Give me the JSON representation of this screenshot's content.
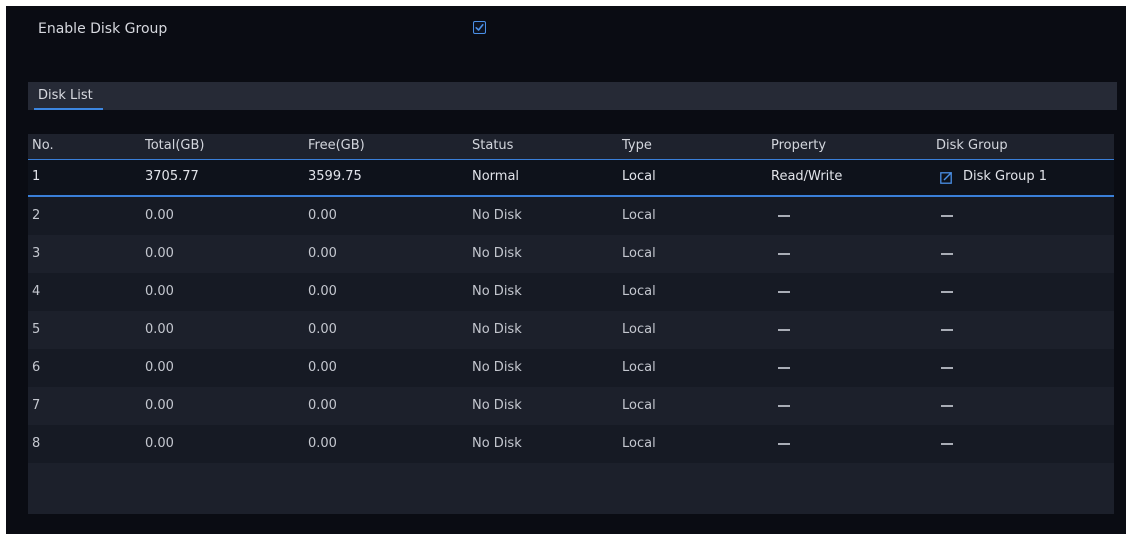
{
  "enable": {
    "label": "Enable Disk Group",
    "checked": true,
    "icon": "checkbox-checked-icon"
  },
  "tabs": [
    {
      "label": "Disk List",
      "active": true
    }
  ],
  "table": {
    "headers": [
      "No.",
      "Total(GB)",
      "Free(GB)",
      "Status",
      "Type",
      "Property",
      "Disk Group"
    ],
    "rows": [
      {
        "no": "1",
        "total": "3705.77",
        "free": "3599.75",
        "status": "Normal",
        "type": "Local",
        "property": "Read/Write",
        "disk_group": "Disk Group 1",
        "selected": true
      },
      {
        "no": "2",
        "total": "0.00",
        "free": "0.00",
        "status": "No Disk",
        "type": "Local",
        "property": "–",
        "disk_group": "–"
      },
      {
        "no": "3",
        "total": "0.00",
        "free": "0.00",
        "status": "No Disk",
        "type": "Local",
        "property": "–",
        "disk_group": "–"
      },
      {
        "no": "4",
        "total": "0.00",
        "free": "0.00",
        "status": "No Disk",
        "type": "Local",
        "property": "–",
        "disk_group": "–"
      },
      {
        "no": "5",
        "total": "0.00",
        "free": "0.00",
        "status": "No Disk",
        "type": "Local",
        "property": "–",
        "disk_group": "–"
      },
      {
        "no": "6",
        "total": "0.00",
        "free": "0.00",
        "status": "No Disk",
        "type": "Local",
        "property": "–",
        "disk_group": "–"
      },
      {
        "no": "7",
        "total": "0.00",
        "free": "0.00",
        "status": "No Disk",
        "type": "Local",
        "property": "–",
        "disk_group": "–"
      },
      {
        "no": "8",
        "total": "0.00",
        "free": "0.00",
        "status": "No Disk",
        "type": "Local",
        "property": "–",
        "disk_group": "–"
      }
    ],
    "edit_icon": "edit-icon"
  },
  "colors": {
    "background": "#0a0c13",
    "accent": "#3c86e0",
    "text": "#d6d8de"
  }
}
